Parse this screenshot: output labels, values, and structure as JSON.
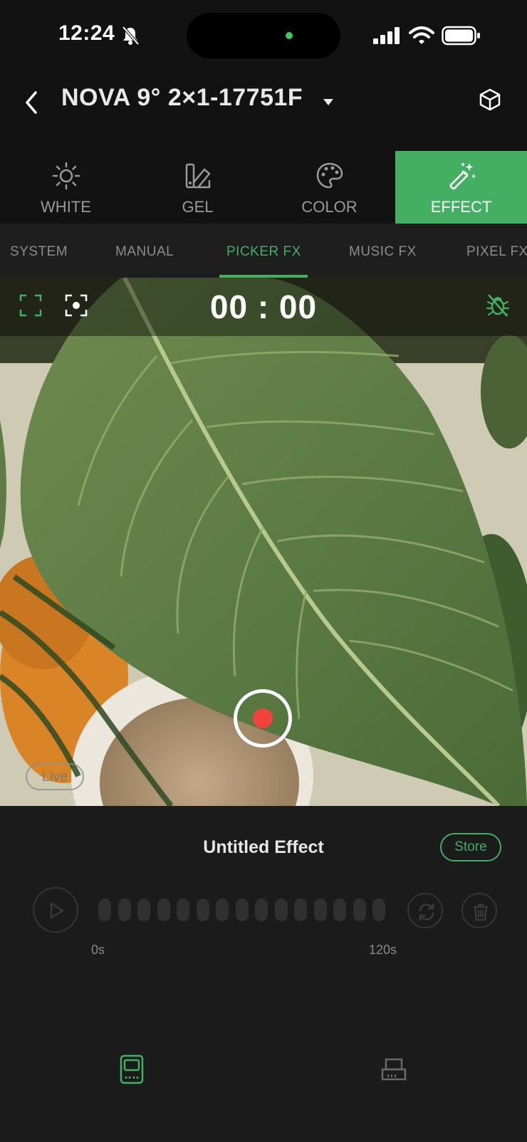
{
  "status_bar": {
    "time": "12:24",
    "icons": [
      "bell-slash-icon",
      "signal-icon",
      "wifi-icon",
      "battery-icon"
    ],
    "indicator_color": "#3ec85f"
  },
  "header": {
    "back_icon": "chevron-left-icon",
    "device_name": "NOVA 9° 2×1-17751F",
    "dropdown_icon": "caret-down-icon",
    "cube_icon": "cube-icon"
  },
  "modes": [
    {
      "label": "WHITE",
      "icon": "sun-icon"
    },
    {
      "label": "GEL",
      "icon": "gel-swatch-icon"
    },
    {
      "label": "COLOR",
      "icon": "palette-icon"
    },
    {
      "label": "EFFECT",
      "icon": "magic-wand-icon",
      "active": true
    }
  ],
  "subtabs": [
    {
      "label": "SYSTEM"
    },
    {
      "label": "MANUAL"
    },
    {
      "label": "PICKER FX",
      "active": true
    },
    {
      "label": "MUSIC FX"
    },
    {
      "label": "PIXEL FX"
    }
  ],
  "camera": {
    "timer": "00 : 00",
    "live_label": "Live",
    "icons": [
      "fullscreen-icon",
      "focus-icon",
      "bug-off-icon",
      "record-icon"
    ]
  },
  "effect": {
    "title": "Untitled Effect",
    "store_label": "Store",
    "timeline_start": "0s",
    "timeline_end": "120s",
    "segment_count": 15,
    "icons": [
      "play-icon",
      "loop-icon",
      "trash-icon"
    ]
  },
  "bottom_nav": [
    "device-remote-icon",
    "fixture-icon"
  ],
  "colors": {
    "accent": "#44ae62",
    "record": "#f1423d",
    "background": "#1b1b1b"
  }
}
